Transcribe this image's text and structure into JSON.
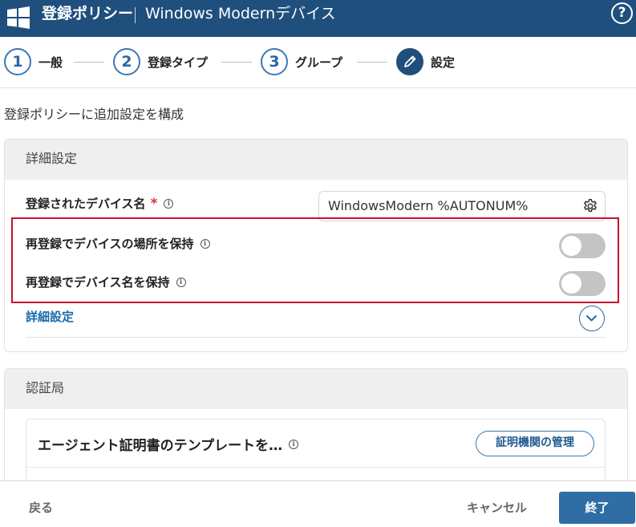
{
  "header": {
    "title": "登録ポリシー",
    "subtitle": "Windows Modernデバイス",
    "help_glyph": "?",
    "logo_icon": "windows-logo-icon",
    "background": "#1f4f7c"
  },
  "stepper": {
    "steps": [
      {
        "number": "1",
        "label": "一般"
      },
      {
        "number": "2",
        "label": "登録タイプ"
      },
      {
        "number": "3",
        "label": "グループ"
      },
      {
        "number": "",
        "label": "設定",
        "icon": "pencil-icon",
        "active": true
      }
    ]
  },
  "intro": "登録ポリシーに追加設定を構成",
  "details_section": {
    "title": "詳細設定",
    "device_name": {
      "label": "登録されたデバイス名",
      "required_mark": "*",
      "info_glyph": "i",
      "value": "WindowsModern %AUTONUM%"
    },
    "toggles": [
      {
        "label": "再登録でデバイスの場所を保持",
        "info_glyph": "i",
        "on": false
      },
      {
        "label": "再登録でデバイス名を保持",
        "info_glyph": "i",
        "on": false
      }
    ],
    "advanced_link": "詳細設定"
  },
  "ca_section": {
    "title": "認証局",
    "template_label": "エージェント証明書のテンプレートを…",
    "info_glyph": "i",
    "manage_button": "証明機関の管理"
  },
  "footer": {
    "back": "戻る",
    "cancel": "キャンセル",
    "finish": "終了"
  },
  "colors": {
    "accent": "#2f6da4",
    "highlight": "#c8102e",
    "toggle_off": "#c4c4c4"
  }
}
